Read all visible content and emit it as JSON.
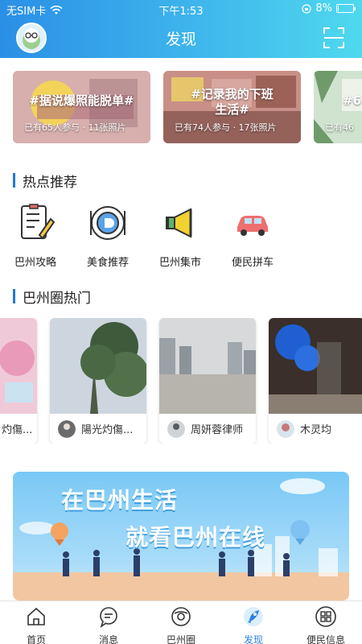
{
  "status_bar": {
    "carrier": "无SIM卡",
    "time": "下午1:53",
    "battery": "8%",
    "battery_level": 0.08
  },
  "navbar": {
    "title": "发现"
  },
  "topics": [
    {
      "title": "#据说爆照能脱单#",
      "meta": "已有65人参与 · 11张照片"
    },
    {
      "title": "#记录我的下班生活#",
      "meta": "已有74人参与 · 17张照片"
    },
    {
      "title": "#6",
      "meta": "已有46"
    }
  ],
  "hot": {
    "title": "热点推荐",
    "items": [
      {
        "label": "巴州攻略",
        "icon": "guide-icon"
      },
      {
        "label": "美食推荐",
        "icon": "food-icon"
      },
      {
        "label": "巴州集市",
        "icon": "megaphone-icon"
      },
      {
        "label": "便民拼车",
        "icon": "car-icon"
      }
    ]
  },
  "circle": {
    "title": "巴州圈热门",
    "posts": [
      {
        "user": "灼傷..."
      },
      {
        "user": "陽光灼傷..."
      },
      {
        "user": "周妍蓉律师"
      },
      {
        "user": "木灵均"
      }
    ]
  },
  "banner": {
    "line1": "在巴州生活",
    "line2": "就看巴州在线"
  },
  "tabs": [
    {
      "label": "首页",
      "icon": "home-icon"
    },
    {
      "label": "消息",
      "icon": "message-icon"
    },
    {
      "label": "巴州圈",
      "icon": "circle-icon"
    },
    {
      "label": "发现",
      "icon": "rocket-icon",
      "active": true
    },
    {
      "label": "便民信息",
      "icon": "grid-icon"
    }
  ],
  "colors": {
    "accent": "#2b83e0",
    "header_start": "#2a8fe6",
    "header_end": "#4fd9ee"
  }
}
